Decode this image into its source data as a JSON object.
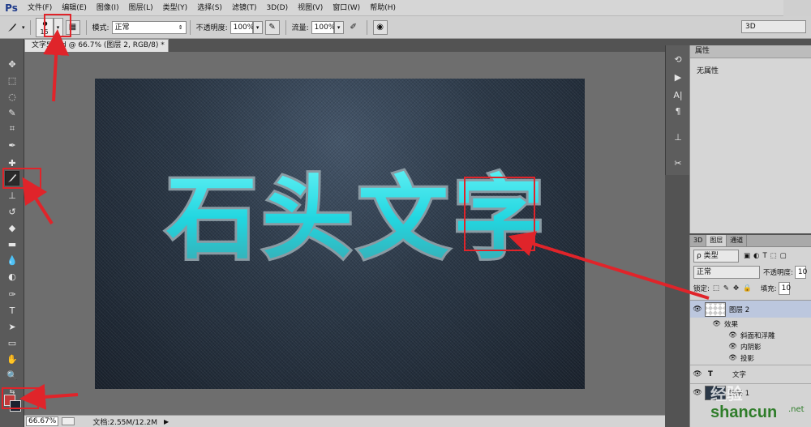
{
  "app": {
    "logo": "Ps"
  },
  "menu": [
    "文件(F)",
    "编辑(E)",
    "图像(I)",
    "图层(L)",
    "类型(Y)",
    "选择(S)",
    "滤镜(T)",
    "3D(D)",
    "视图(V)",
    "窗口(W)",
    "帮助(H)"
  ],
  "options": {
    "brush_size": "15",
    "mode_label": "模式:",
    "mode_value": "正常",
    "opacity_label": "不透明度:",
    "opacity_value": "100%",
    "flow_label": "流量:",
    "flow_value": "100%",
    "workspace": "3D"
  },
  "document": {
    "tab_title": "文字5.psd @ 66.7% (图层 2, RGB/8) *",
    "canvas_text": "石头文字",
    "zoom": "66.67%",
    "doc_size": "文档:2.55M/12.2M"
  },
  "properties": {
    "tab": "属性",
    "empty_text": "无属性"
  },
  "layers": {
    "tabs": [
      "3D",
      "图层",
      "通道"
    ],
    "filter_kind": "ρ 类型",
    "blend_mode": "正常",
    "opacity_label": "不透明度:",
    "opacity_value": "10",
    "lock_label": "锁定:",
    "fill_label": "填充:",
    "fill_value": "10",
    "rows": [
      {
        "name": "图层 2"
      },
      {
        "name": "效果"
      },
      {
        "name": "斜面和浮雕"
      },
      {
        "name": "内阴影"
      },
      {
        "name": "投影"
      },
      {
        "name": "文字"
      },
      {
        "name": "图层 1"
      }
    ]
  },
  "watermark": {
    "line1": "经验",
    "line2": "shancun",
    "suffix": ".net"
  },
  "colors": {
    "annotation_red": "#e0242a",
    "text_cyan": "#22d6e0",
    "foreground": "#c43a3a",
    "background": "#1a2230"
  }
}
